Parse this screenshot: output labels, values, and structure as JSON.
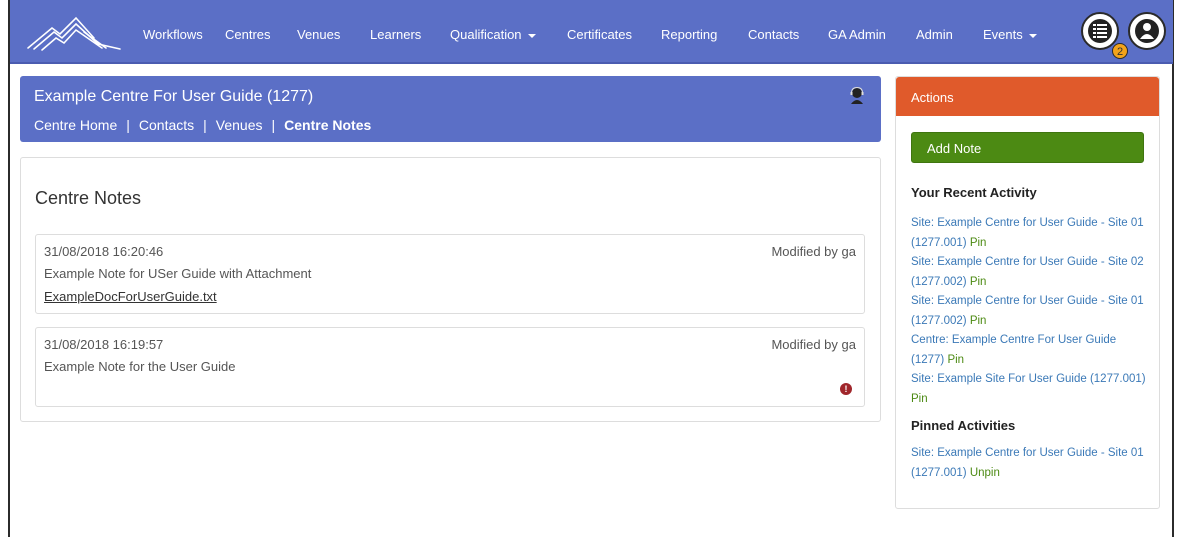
{
  "nav": {
    "items": [
      {
        "label": "Workflows",
        "dropdown": false
      },
      {
        "label": "Centres",
        "dropdown": false
      },
      {
        "label": "Venues",
        "dropdown": false
      },
      {
        "label": "Learners",
        "dropdown": false
      },
      {
        "label": "Qualification",
        "dropdown": true
      },
      {
        "label": "Certificates",
        "dropdown": false
      },
      {
        "label": "Reporting",
        "dropdown": false
      },
      {
        "label": "Contacts",
        "dropdown": false
      },
      {
        "label": "GA Admin",
        "dropdown": false
      },
      {
        "label": "Admin",
        "dropdown": false
      },
      {
        "label": "Events",
        "dropdown": true
      }
    ],
    "tasks_badge": "2",
    "tasks_icon": "list-icon",
    "user_icon": "user-icon"
  },
  "centre": {
    "title": "Example Centre For User Guide (1277)",
    "crumbs": [
      "Centre Home",
      "Contacts",
      "Venues",
      "Centre Notes"
    ],
    "separator": "|"
  },
  "notes": {
    "title": "Centre Notes",
    "items": [
      {
        "date": "31/08/2018 16:20:46",
        "modified": "Modified by ga",
        "text": "Example Note for USer Guide with Attachment",
        "attachment": "ExampleDocForUserGuide.txt"
      },
      {
        "date": "31/08/2018 16:19:57",
        "modified": "Modified by ga",
        "text": "Example Note for the User Guide",
        "warning": "!"
      }
    ]
  },
  "actions": {
    "title": "Actions",
    "add_note": "Add Note",
    "recent_title": "Your Recent Activity",
    "recent": [
      {
        "label": "Site: Example Centre for User Guide - Site 01 (1277.001)",
        "action": "Pin"
      },
      {
        "label": "Site: Example Centre for User Guide - Site 02 (1277.002)",
        "action": "Pin"
      },
      {
        "label": "Site: Example Centre for User Guide - Site 01 (1277.002)",
        "action": "Pin"
      },
      {
        "label": "Centre: Example Centre For User Guide (1277)",
        "action": "Pin"
      },
      {
        "label": "Site: Example Site For User Guide (1277.001)",
        "action": "Pin"
      }
    ],
    "pinned_title": "Pinned Activities",
    "pinned": [
      {
        "label": "Site: Example Centre for User Guide - Site 01 (1277.001)",
        "action": "Unpin"
      }
    ]
  },
  "colors": {
    "navbar": "#5b6fc6",
    "actions_header": "#e05a2b",
    "add_note": "#4c8a13",
    "link": "#3b79b7",
    "pin": "#4c8a13",
    "badge": "#f3a31b"
  }
}
